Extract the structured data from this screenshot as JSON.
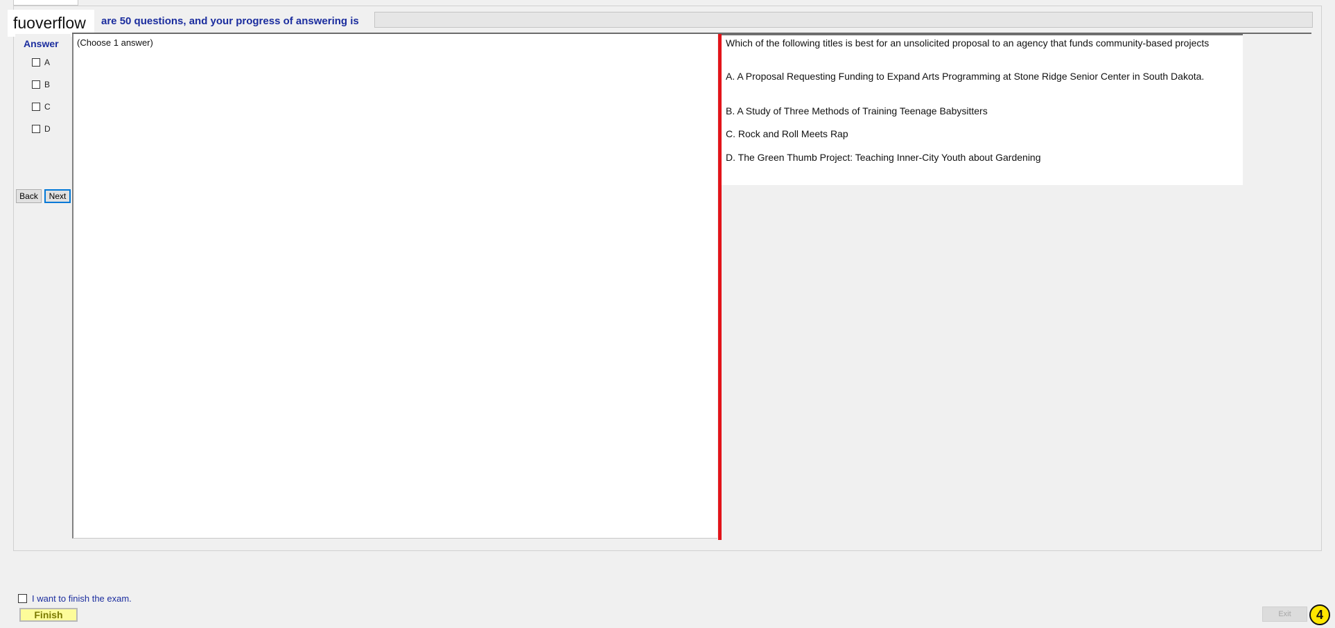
{
  "watermark": "fuoverflow",
  "progress": {
    "label": "are 50 questions, and your progress of answering is",
    "fraction": 0.0,
    "fill_color": "#6aa84f"
  },
  "answer_panel": {
    "heading": "Answer",
    "options": [
      "A",
      "B",
      "C",
      "D"
    ],
    "back_label": "Back",
    "next_label": "Next"
  },
  "middle_panel": {
    "hint": "(Choose 1 answer)"
  },
  "question": {
    "text": "Which of the following titles is best for an unsolicited proposal to an agency that funds community-based projects",
    "choices": [
      "A.  A Proposal Requesting Funding to Expand Arts Programming at Stone Ridge Senior Center in South Dakota.",
      "B.  A Study of Three Methods of Training Teenage Babysitters",
      "C.  Rock and Roll Meets Rap",
      "D.  The Green Thumb Project: Teaching Inner-City Youth about Gardening"
    ]
  },
  "footer": {
    "finish_check_label": "I want to finish the exam.",
    "finish_label": "Finish",
    "exit_label": "Exit",
    "badge_value": "4"
  },
  "colors": {
    "accent_blue": "#1b2d9e",
    "splitter_red": "#e2141a",
    "finish_yellow": "#fdfc9a",
    "badge_yellow": "#ffe600"
  }
}
